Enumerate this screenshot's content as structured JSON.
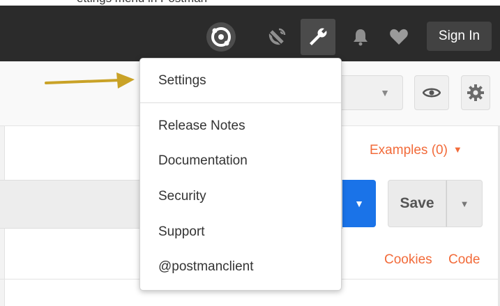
{
  "caption": "ettings menu in Postman",
  "header": {
    "sign_in_label": "Sign In",
    "icons": [
      "sync-icon",
      "satellite-antenna-icon",
      "wrench-icon",
      "bell-icon",
      "heart-icon"
    ]
  },
  "toolbar": {
    "eye_icon": "eye-icon",
    "gear_icon": "gear-icon"
  },
  "request": {
    "examples_label": "Examples (0)",
    "save_label": "Save",
    "cookies_label": "Cookies",
    "code_label": "Code"
  },
  "menu": {
    "items": [
      {
        "label": "Settings"
      },
      {
        "label": "Release Notes"
      },
      {
        "label": "Documentation"
      },
      {
        "label": "Security"
      },
      {
        "label": "Support"
      },
      {
        "label": "@postmanclient"
      }
    ]
  },
  "colors": {
    "header_bg": "#2b2b2b",
    "accent_orange": "#f26b3a",
    "send_blue": "#1a73e8",
    "arrow_gold": "#c9a227"
  }
}
